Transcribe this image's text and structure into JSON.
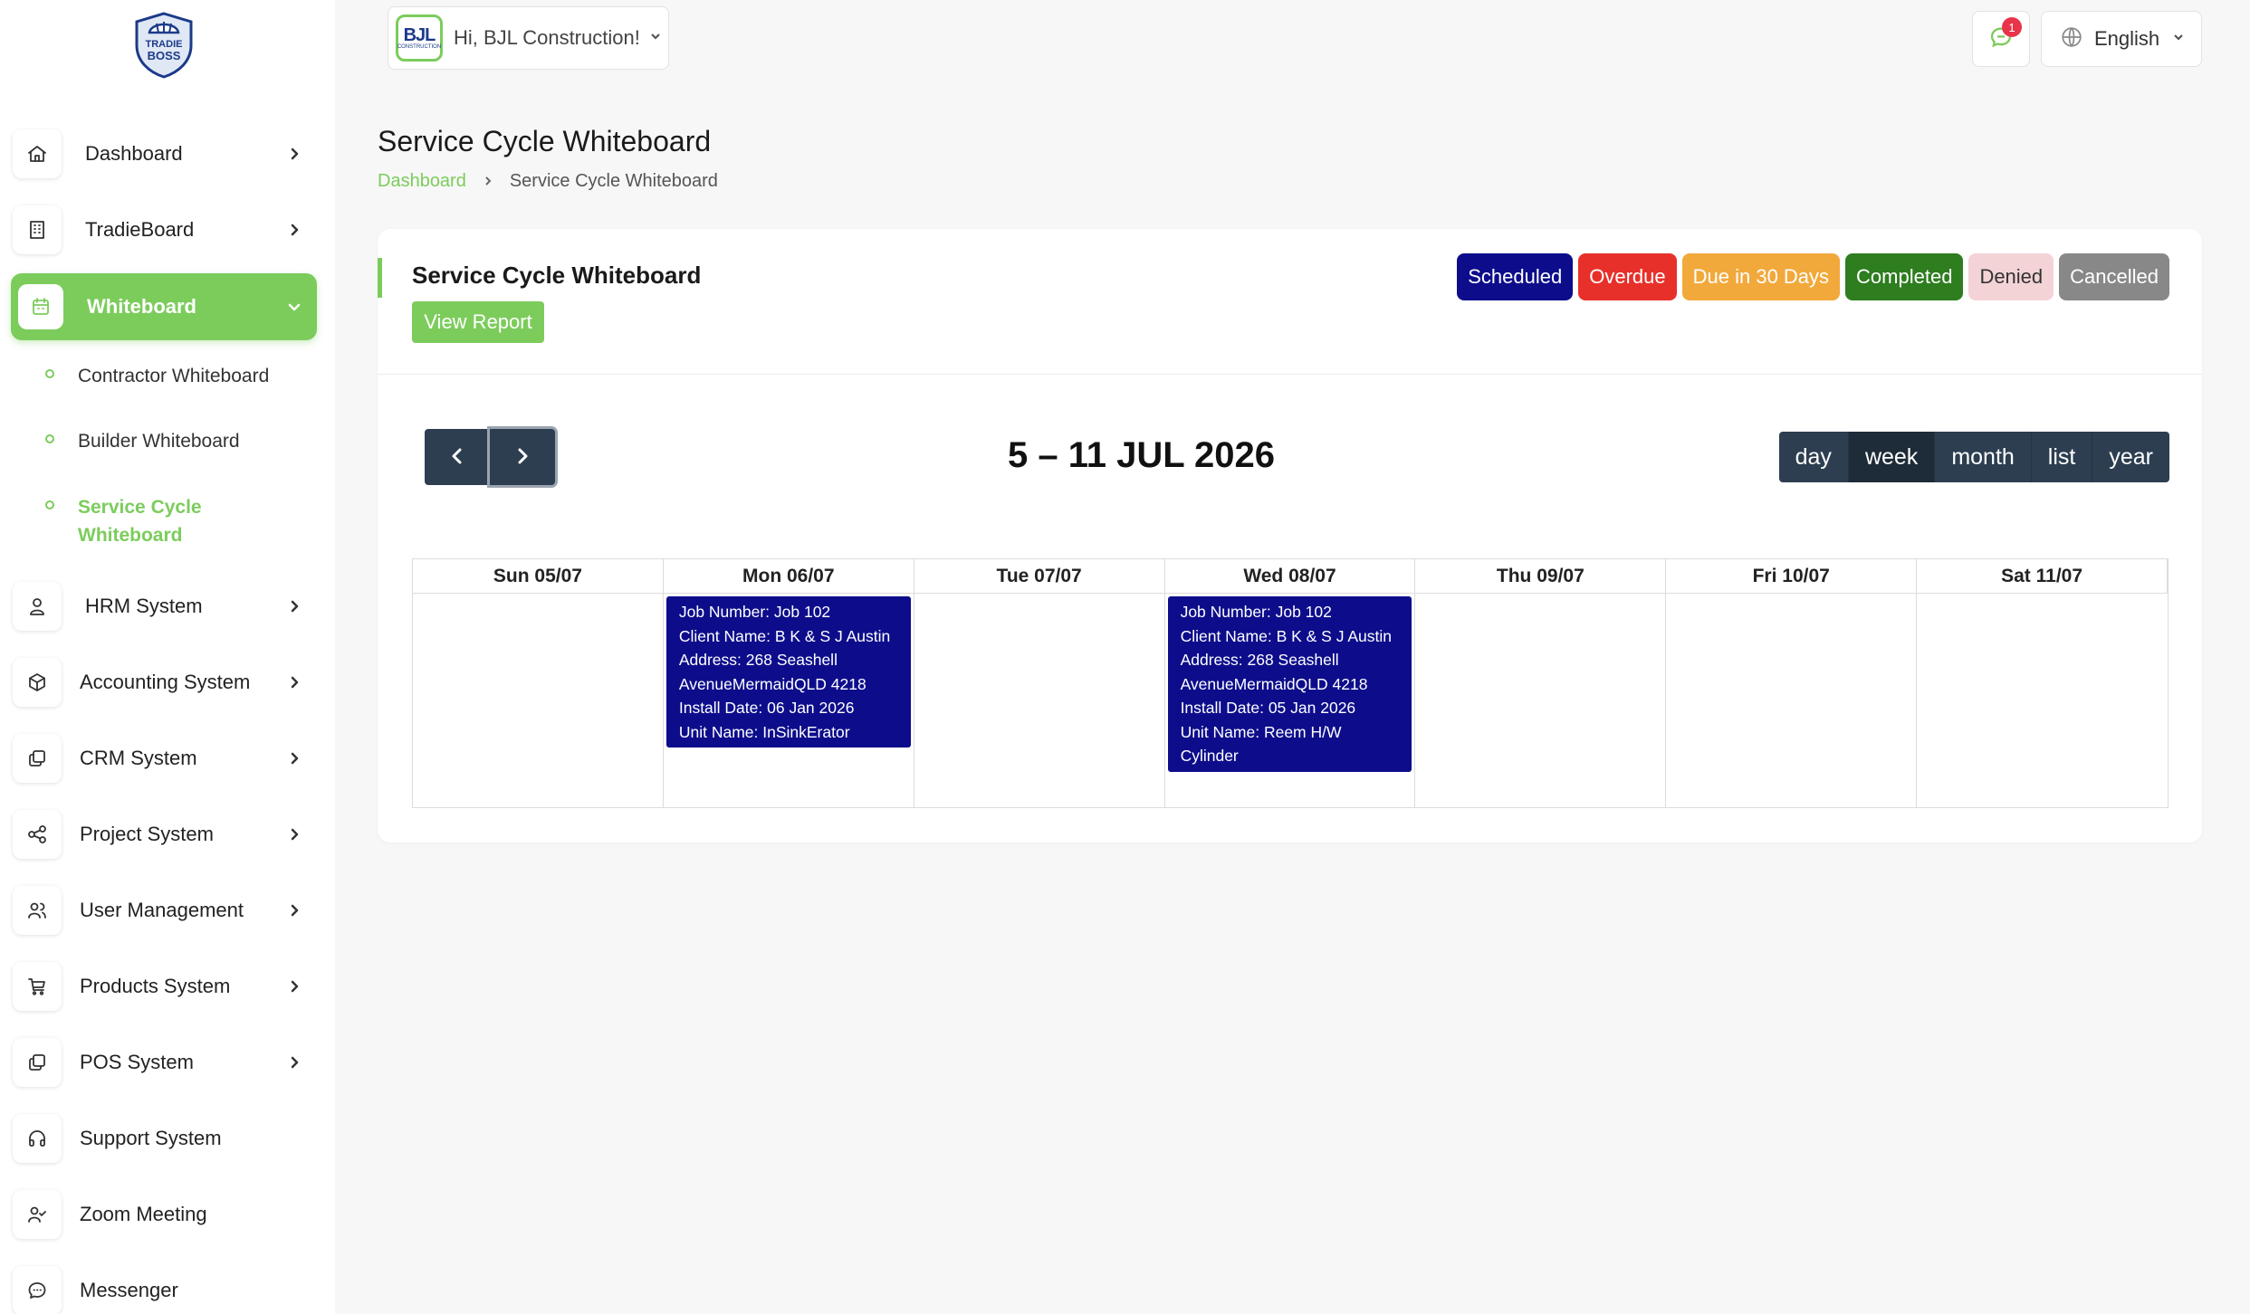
{
  "brand": {
    "logo_line1": "TRADIE",
    "logo_line2": "BOSS"
  },
  "sidebar": {
    "items": [
      {
        "label": "Dashboard",
        "icon": "home-icon"
      },
      {
        "label": "TradieBoard",
        "icon": "building-icon"
      },
      {
        "label": "Whiteboard",
        "icon": "calendar-icon"
      },
      {
        "label": "HRM System",
        "icon": "user-icon"
      },
      {
        "label": "Accounting System",
        "icon": "box-icon"
      },
      {
        "label": "CRM System",
        "icon": "layers-icon"
      },
      {
        "label": "Project System",
        "icon": "share-icon"
      },
      {
        "label": "User Management",
        "icon": "users-icon"
      },
      {
        "label": "Products System",
        "icon": "cart-icon"
      },
      {
        "label": "POS System",
        "icon": "layers-icon"
      },
      {
        "label": "Support System",
        "icon": "headphones-icon"
      },
      {
        "label": "Zoom Meeting",
        "icon": "user-check-icon"
      },
      {
        "label": "Messenger",
        "icon": "message-icon"
      }
    ],
    "whiteboard_sub": [
      {
        "label": "Contractor Whiteboard"
      },
      {
        "label": "Builder Whiteboard"
      },
      {
        "label": "Service Cycle Whiteboard"
      }
    ]
  },
  "header": {
    "company_logo_text": "BJL",
    "company_logo_sub": "CONSTRUCTION",
    "greeting": "Hi, BJL Construction!",
    "notification_count": "1",
    "language": "English"
  },
  "page": {
    "title": "Service Cycle Whiteboard",
    "breadcrumb": [
      "Dashboard",
      "Service Cycle Whiteboard"
    ]
  },
  "card": {
    "title": "Service Cycle Whiteboard",
    "view_report": "View Report",
    "legend": [
      {
        "label": "Scheduled",
        "color": "#0d0d8c",
        "text_color": "#ffffff"
      },
      {
        "label": "Overdue",
        "color": "#e8302a",
        "text_color": "#ffffff"
      },
      {
        "label": "Due in 30 Days",
        "color": "#f2a93b",
        "text_color": "#ffffff"
      },
      {
        "label": "Completed",
        "color": "#2e7d1f",
        "text_color": "#ffffff"
      },
      {
        "label": "Denied",
        "color": "#f3d3d6",
        "text_color": "#333333"
      },
      {
        "label": "Cancelled",
        "color": "#888888",
        "text_color": "#ffffff"
      }
    ]
  },
  "calendar": {
    "range": "5 – 11 JUL 2026",
    "views": [
      "day",
      "week",
      "month",
      "list",
      "year"
    ],
    "active_view": "week",
    "days": [
      "Sun 05/07",
      "Mon 06/07",
      "Tue 07/07",
      "Wed 08/07",
      "Thu 09/07",
      "Fri 10/07",
      "Sat 11/07"
    ],
    "events": [
      {
        "day": "Mon 06/07",
        "status": "Scheduled",
        "lines": [
          "Job Number: Job 102",
          "Client Name: B K & S J Austin",
          "Address: 268 Seashell AvenueMermaidQLD 4218",
          "Install Date: 06 Jan 2026",
          "Unit Name: InSinkErator"
        ]
      },
      {
        "day": "Wed 08/07",
        "status": "Scheduled",
        "lines": [
          "Job Number: Job 102",
          "Client Name: B K & S J Austin",
          "Address: 268 Seashell AvenueMermaidQLD 4218",
          "Install Date: 05 Jan 2026",
          "Unit Name: Reem H/W Cylinder"
        ]
      }
    ]
  }
}
